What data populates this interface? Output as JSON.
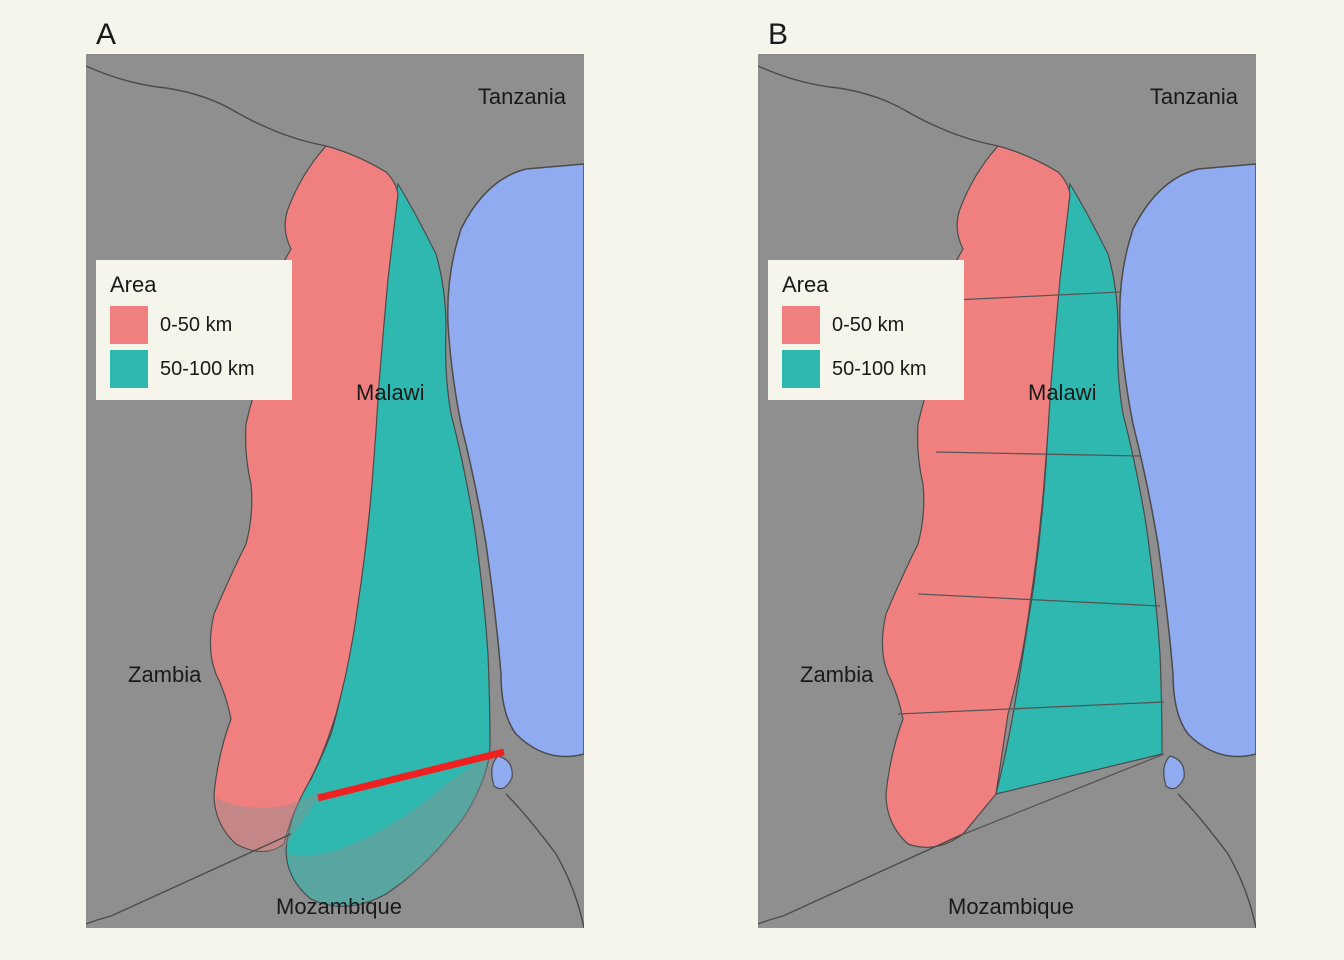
{
  "panels": {
    "A": {
      "letter": "A"
    },
    "B": {
      "letter": "B"
    }
  },
  "countries": {
    "tanzania": "Tanzania",
    "malawi": "Malawi",
    "zambia": "Zambia",
    "mozambique": "Mozambique"
  },
  "legend": {
    "title": "Area",
    "items": [
      {
        "label": "0-50 km",
        "color": "#f08080"
      },
      {
        "label": "50-100 km",
        "color": "#2fb8b0"
      }
    ]
  },
  "colors": {
    "panel_bg": "#f5f5eb",
    "map_bg": "#8f8f8f",
    "lake": "#90abef",
    "border": "#4b4b4b",
    "zone_near": "#f08080",
    "zone_far": "#2fb8b0",
    "red_line": "#ef2020",
    "segment": "#555555",
    "zone_near_faded": "#c28888",
    "zone_far_faded": "#5a9d99"
  }
}
